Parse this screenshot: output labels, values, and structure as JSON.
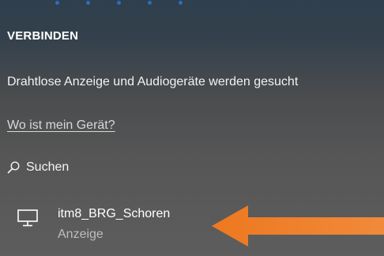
{
  "section": {
    "heading": "VERBINDEN",
    "status": "Drahtlose Anzeige und Audiogeräte werden gesucht",
    "help_link": "Wo ist mein Gerät?"
  },
  "search": {
    "label": "Suchen",
    "icon": "search-icon"
  },
  "devices": [
    {
      "name": "itm8_BRG_Schoren",
      "type": "Anzeige",
      "icon": "monitor-icon"
    }
  ],
  "annotation": {
    "icon": "arrow-left-icon",
    "color": "#f07d1e"
  },
  "colors": {
    "top_dots": "#2d6fb8"
  }
}
